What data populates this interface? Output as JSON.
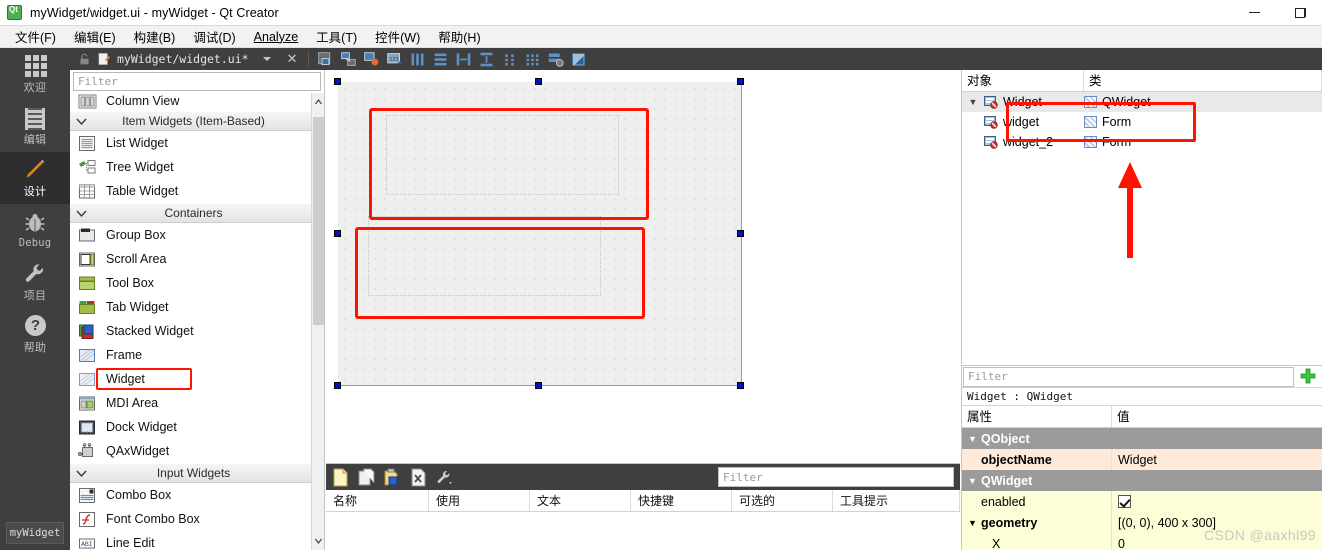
{
  "window": {
    "title": "myWidget/widget.ui - myWidget - Qt Creator",
    "app_icon": "qt-logo-icon",
    "minimize": "minimize-icon",
    "maximize": "maximize-icon"
  },
  "menubar": {
    "items": [
      {
        "label": "文件(F)",
        "mnemonic": "F"
      },
      {
        "label": "编辑(E)",
        "mnemonic": "E"
      },
      {
        "label": "构建(B)",
        "mnemonic": "B"
      },
      {
        "label": "调试(D)",
        "mnemonic": "D"
      },
      {
        "label": "Analyze",
        "mnemonic": "A"
      },
      {
        "label": "工具(T)",
        "mnemonic": "T"
      },
      {
        "label": "控件(W)",
        "mnemonic": "W"
      },
      {
        "label": "帮助(H)",
        "mnemonic": "H"
      }
    ]
  },
  "modebar": {
    "items": [
      {
        "label": "欢迎",
        "icon": "grid-icon",
        "active": false
      },
      {
        "label": "编辑",
        "icon": "document-icon",
        "active": false
      },
      {
        "label": "设计",
        "icon": "pencil-icon",
        "active": true
      },
      {
        "label": "Debug",
        "icon": "bug-icon",
        "active": false
      },
      {
        "label": "项目",
        "icon": "wrench-icon",
        "active": false
      },
      {
        "label": "帮助",
        "icon": "question-circle-icon",
        "active": false
      }
    ],
    "project_chip": "myWidget"
  },
  "designer_toolbar": {
    "lock_icon": "unlocked-icon",
    "file_icon": "ui-file-icon",
    "document": "myWidget/widget.ui*",
    "dropdown_icon": "chevron-down-icon",
    "close_icon": "close-icon",
    "tools": [
      "edit-widgets-icon",
      "edit-signals-slots-icon",
      "edit-buddies-icon",
      "edit-tab-order-icon",
      "layout-horizontally-icon",
      "layout-vertically-icon",
      "layout-splitter-horizontal-icon",
      "layout-splitter-vertical-icon",
      "layout-form-icon",
      "layout-grid-icon",
      "break-layout-icon",
      "adjust-size-icon"
    ]
  },
  "widget_box": {
    "filter_placeholder": "Filter",
    "items": [
      {
        "type": "item",
        "label": "Column View",
        "icon": "column-view-icon",
        "partial": true
      },
      {
        "type": "category",
        "label": "Item Widgets (Item-Based)",
        "icon": "chevron-down-icon"
      },
      {
        "type": "item",
        "label": "List Widget",
        "icon": "list-widget-icon"
      },
      {
        "type": "item",
        "label": "Tree Widget",
        "icon": "tree-widget-icon"
      },
      {
        "type": "item",
        "label": "Table Widget",
        "icon": "table-widget-icon"
      },
      {
        "type": "category",
        "label": "Containers",
        "icon": "chevron-down-icon"
      },
      {
        "type": "item",
        "label": "Group Box",
        "icon": "group-box-icon"
      },
      {
        "type": "item",
        "label": "Scroll Area",
        "icon": "scroll-area-icon"
      },
      {
        "type": "item",
        "label": "Tool Box",
        "icon": "tool-box-icon"
      },
      {
        "type": "item",
        "label": "Tab Widget",
        "icon": "tab-widget-icon"
      },
      {
        "type": "item",
        "label": "Stacked Widget",
        "icon": "stacked-widget-icon"
      },
      {
        "type": "item",
        "label": "Frame",
        "icon": "frame-icon"
      },
      {
        "type": "item",
        "label": "Widget",
        "icon": "widget-icon",
        "highlighted": true
      },
      {
        "type": "item",
        "label": "MDI Area",
        "icon": "mdi-area-icon"
      },
      {
        "type": "item",
        "label": "Dock Widget",
        "icon": "dock-widget-icon"
      },
      {
        "type": "item",
        "label": "QAxWidget",
        "icon": "qax-widget-icon"
      },
      {
        "type": "category",
        "label": "Input Widgets",
        "icon": "chevron-down-icon"
      },
      {
        "type": "item",
        "label": "Combo Box",
        "icon": "combo-box-icon"
      },
      {
        "type": "item",
        "label": "Font Combo Box",
        "icon": "font-combo-box-icon"
      },
      {
        "type": "item",
        "label": "Line Edit",
        "icon": "line-edit-icon"
      }
    ]
  },
  "form_canvas": {
    "form_size": "400 x 300",
    "annotation_color": "#ff1200",
    "selection_handle_color": "#0013c8",
    "children": [
      "widget",
      "widget_2"
    ]
  },
  "action_editor": {
    "tools": [
      "new-action-icon",
      "copy-icon",
      "paste-icon",
      "delete-icon",
      "configure-icon"
    ],
    "filter_placeholder": "Filter",
    "columns": [
      "名称",
      "使用",
      "文本",
      "快捷键",
      "可选的",
      "工具提示"
    ],
    "rows": []
  },
  "object_inspector": {
    "columns": [
      "对象",
      "类"
    ],
    "rows": [
      {
        "name": "Widget",
        "class": "QWidget",
        "depth": 0,
        "expandable": true,
        "selected": true,
        "icon": "form-icon",
        "class_icon": "widget-hatch-icon"
      },
      {
        "name": "widget",
        "class": "Form",
        "depth": 1,
        "expandable": false,
        "selected": false,
        "icon": "form-icon",
        "class_icon": "widget-hatch-icon"
      },
      {
        "name": "widget_2",
        "class": "Form",
        "depth": 1,
        "expandable": false,
        "selected": false,
        "icon": "form-icon",
        "class_icon": "widget-hatch-icon"
      }
    ]
  },
  "property_editor": {
    "filter_placeholder": "Filter",
    "add_icon": "plus-icon",
    "object_line": "Widget : QWidget",
    "columns": [
      "属性",
      "值"
    ],
    "rows": [
      {
        "kind": "group",
        "name": "QObject",
        "value": "",
        "expanded": true
      },
      {
        "kind": "peach",
        "name": "objectName",
        "value": "Widget",
        "expanded": null
      },
      {
        "kind": "group",
        "name": "QWidget",
        "value": "",
        "expanded": true
      },
      {
        "kind": "cream",
        "name": "enabled",
        "value": "checkbox-checked",
        "expanded": null
      },
      {
        "kind": "cream-bold",
        "name": "geometry",
        "value": "[(0, 0), 400 x 300]",
        "expanded": true
      },
      {
        "kind": "cream-sub",
        "name": "X",
        "value": "0",
        "expanded": null
      }
    ]
  },
  "watermark": "CSDN @aaxhl99"
}
